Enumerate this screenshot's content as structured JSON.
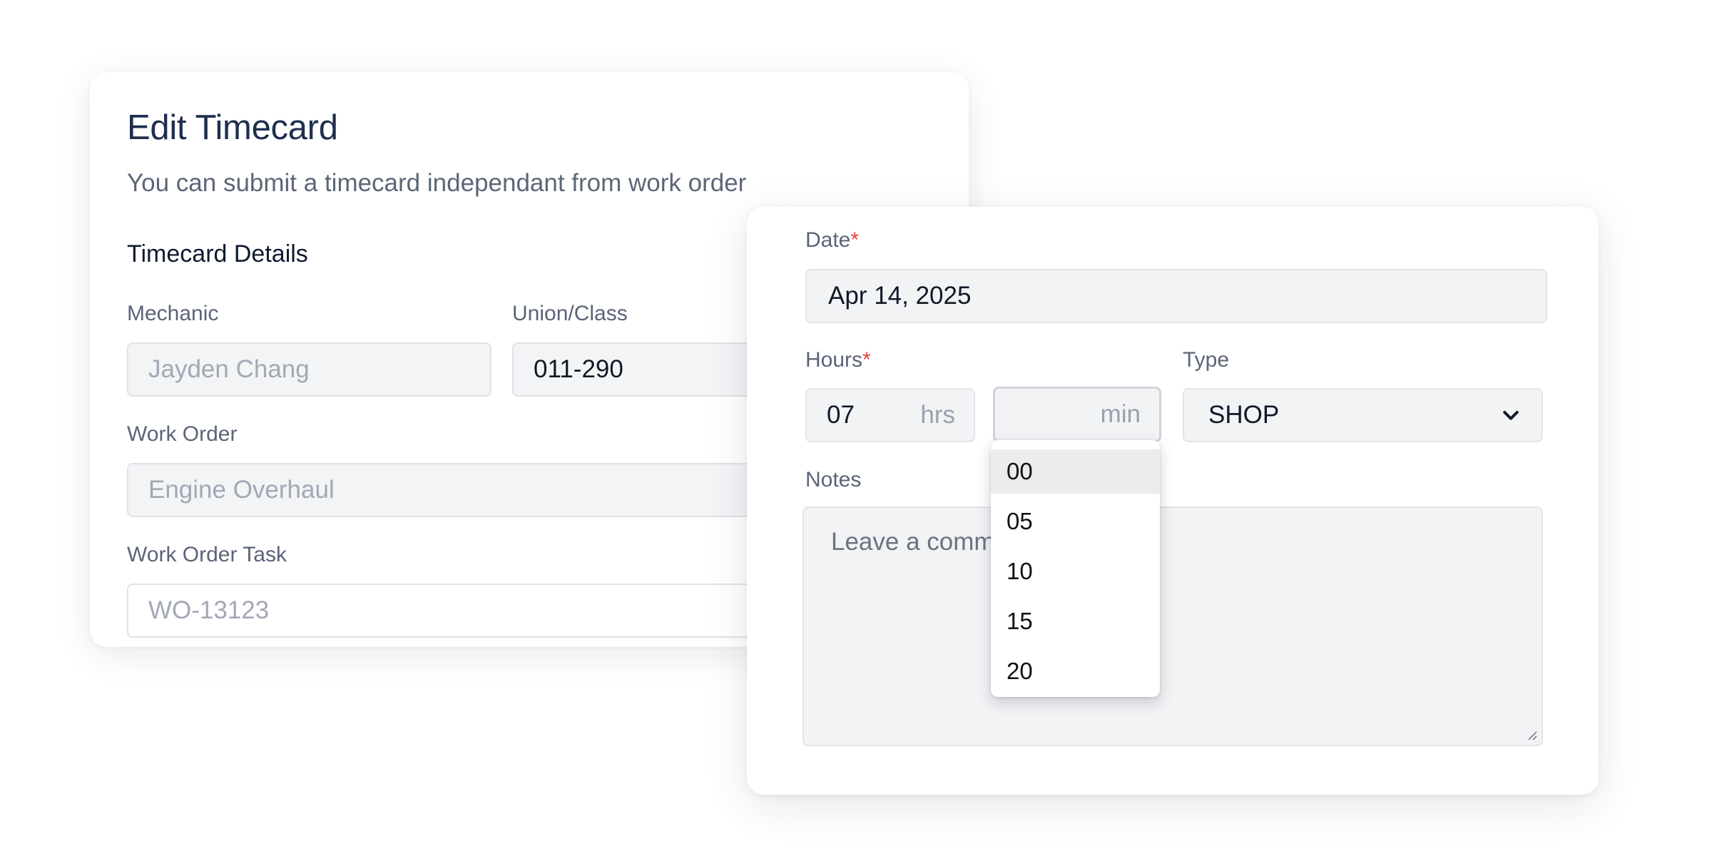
{
  "back_card": {
    "title": "Edit Timecard",
    "subtitle": "You can submit a timecard independant from work order",
    "section_title": "Timecard Details",
    "mechanic": {
      "label": "Mechanic",
      "placeholder": "Jayden Chang"
    },
    "union_class": {
      "label": "Union/Class",
      "value": "011-290"
    },
    "work_order": {
      "label": "Work Order",
      "placeholder": "Engine Overhaul"
    },
    "work_order_task": {
      "label": "Work Order Task",
      "placeholder": "WO-13123"
    }
  },
  "front_card": {
    "date": {
      "label": "Date",
      "required_mark": "*",
      "value": "Apr 14, 2025"
    },
    "hours": {
      "label": "Hours",
      "required_mark": "*",
      "hours_value": "07",
      "hours_unit": "hrs",
      "minutes_value": "",
      "minutes_unit": "min"
    },
    "type": {
      "label": "Type",
      "value": "SHOP",
      "icon": "chevron-down-icon"
    },
    "notes": {
      "label": "Notes",
      "placeholder": "Leave a comment"
    }
  },
  "minutes_dropdown": {
    "highlighted": "00",
    "options": [
      "00",
      "05",
      "10",
      "15",
      "20"
    ]
  },
  "colors": {
    "title": "#1e2f4d",
    "required": "#e0483e",
    "field_bg": "#f3f4f6",
    "field_border": "#dfe2e7",
    "highlight": "#ececec"
  }
}
